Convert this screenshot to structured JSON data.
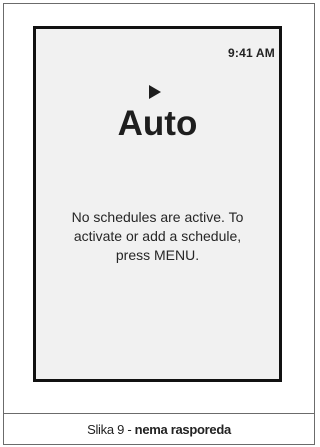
{
  "screen": {
    "time": "9:41 AM",
    "mode_icon": "play-triangle-icon",
    "mode": "Auto",
    "message_line1": "No schedules are active. To",
    "message_line2": "activate or add a schedule,",
    "message_line3": "press MENU."
  },
  "caption": {
    "prefix": "Slika 9 - ",
    "bold": "nema rasporeda"
  },
  "colors": {
    "screen_bg": "#f1f1f1",
    "screen_border": "#111111",
    "frame_border": "#6b6b6b"
  }
}
